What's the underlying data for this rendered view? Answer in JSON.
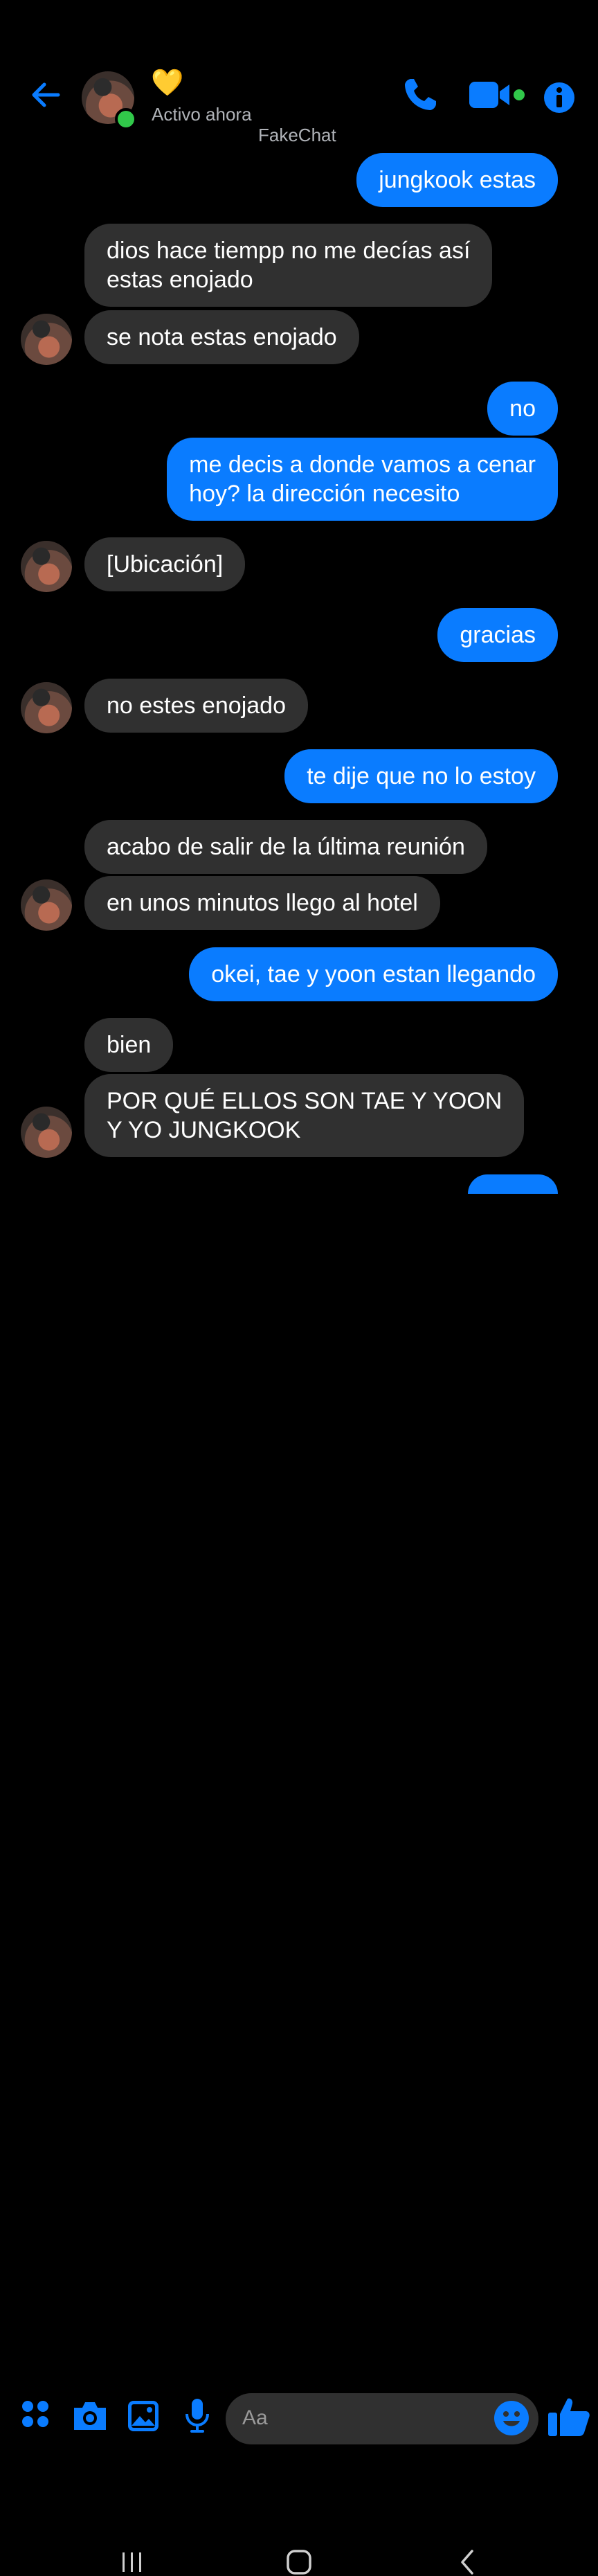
{
  "header": {
    "heart": "💛",
    "status": "Activo ahora",
    "watermark": "FakeChat"
  },
  "colors": {
    "accent": "#0a7cff",
    "bubble_in": "#303030",
    "online": "#31c84a"
  },
  "messages": [
    {
      "dir": "out",
      "text": "jungkook estas"
    },
    {
      "dir": "in",
      "text": "dios hace tiempp no me decías así\nestas enojado"
    },
    {
      "dir": "in",
      "text": "se nota estas enojado"
    },
    {
      "dir": "out",
      "text": "no"
    },
    {
      "dir": "out",
      "text": "me decis a donde vamos a cenar\nhoy? la dirección necesito"
    },
    {
      "dir": "in",
      "text": "[Ubicación]"
    },
    {
      "dir": "out",
      "text": "gracias"
    },
    {
      "dir": "in",
      "text": "no estes enojado"
    },
    {
      "dir": "out",
      "text": "te dije que no lo estoy"
    },
    {
      "dir": "in",
      "text": "acabo de salir de la última reunión"
    },
    {
      "dir": "in",
      "text": "en unos minutos llego al hotel"
    },
    {
      "dir": "out",
      "text": "okei, tae y yoon estan llegando"
    },
    {
      "dir": "in",
      "text": "bien"
    },
    {
      "dir": "in",
      "text": "POR QUÉ ELLOS SON TAE Y YOON\nY YO JUNGKOOK"
    }
  ],
  "composer": {
    "placeholder": "Aa"
  },
  "icons": [
    "back-arrow-icon",
    "phone-icon",
    "video-camera-icon",
    "info-icon",
    "apps-grid-icon",
    "camera-icon",
    "image-icon",
    "microphone-icon",
    "emoji-icon",
    "thumbs-up-icon",
    "recent-apps-icon",
    "home-icon",
    "nav-back-icon"
  ]
}
